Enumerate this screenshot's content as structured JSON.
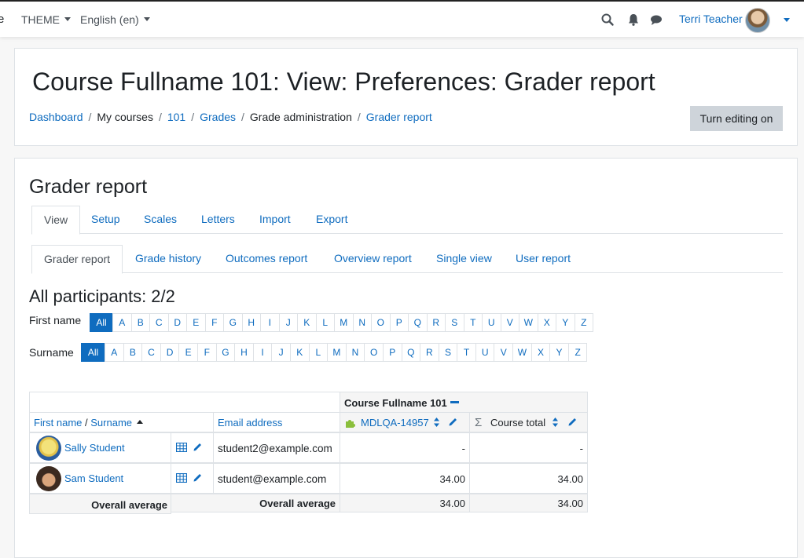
{
  "navbar": {
    "edge_char": "e",
    "theme_menu": "THEME",
    "language_menu": "English (en)",
    "user_name": "Terri Teacher",
    "icons": [
      "search-icon",
      "bell-icon",
      "chat-icon"
    ]
  },
  "header": {
    "title": "Course Fullname 101: View: Preferences: Grader report",
    "breadcrumb": [
      {
        "label": "Dashboard",
        "link": true
      },
      {
        "label": "My courses",
        "link": false
      },
      {
        "label": "101",
        "link": true
      },
      {
        "label": "Grades",
        "link": true
      },
      {
        "label": "Grade administration",
        "link": false
      },
      {
        "label": "Grader report",
        "link": true
      }
    ],
    "editing_button": "Turn editing on"
  },
  "main": {
    "section_title": "Grader report",
    "tabs_primary": [
      "View",
      "Setup",
      "Scales",
      "Letters",
      "Import",
      "Export"
    ],
    "tabs_secondary": [
      "Grader report",
      "Grade history",
      "Outcomes report",
      "Overview report",
      "Single view",
      "User report"
    ],
    "participants": "All participants: 2/2",
    "firstname_label": "First name",
    "surname_label": "Surname",
    "all_label": "All",
    "letters": [
      "A",
      "B",
      "C",
      "D",
      "E",
      "F",
      "G",
      "H",
      "I",
      "J",
      "K",
      "L",
      "M",
      "N",
      "O",
      "P",
      "Q",
      "R",
      "S",
      "T",
      "U",
      "V",
      "W",
      "X",
      "Y",
      "Z"
    ]
  },
  "table": {
    "course_header": "Course Fullname 101",
    "first_name_col": "First name",
    "name_sep": " / ",
    "surname_col": "Surname",
    "email_col": "Email address",
    "item_col": "MDLQA-14957",
    "total_col": "Course total",
    "rows": [
      {
        "name": "Sally Student",
        "email": "student2@example.com",
        "item": "-",
        "total": "-"
      },
      {
        "name": "Sam Student",
        "email": "student@example.com",
        "item": "34.00",
        "total": "34.00"
      }
    ],
    "average_label": "Overall average",
    "average_item": "34.00",
    "average_total": "34.00"
  },
  "colors": {
    "link": "#0f6cbf",
    "button_grey": "#ced4da",
    "active_letter": "#0f6cbf"
  }
}
